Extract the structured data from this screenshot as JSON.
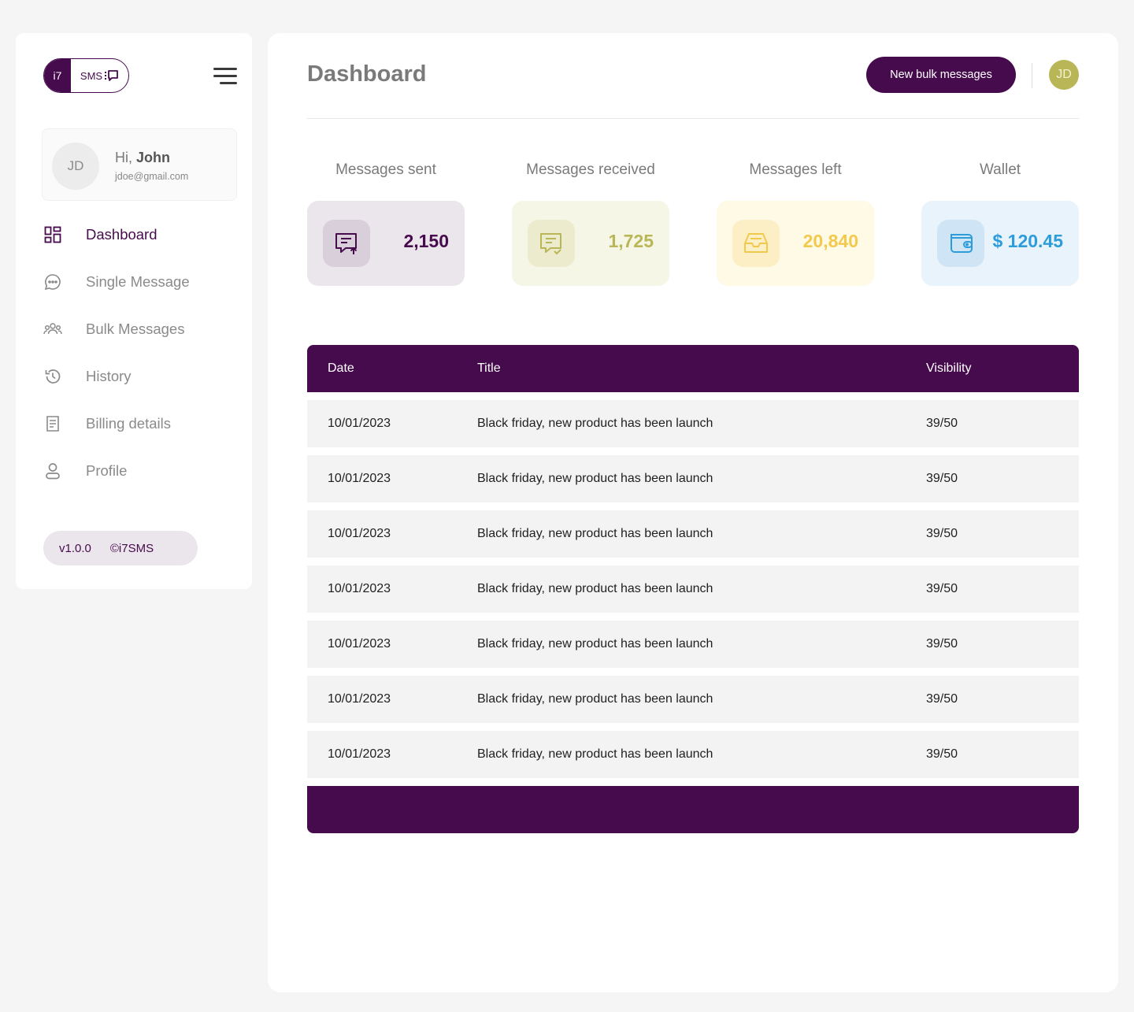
{
  "colors": {
    "brand": "#460b4c",
    "page_bg": "#f5f5f5",
    "sent_bg": "#ebe5ec",
    "received_bg": "#f6f6e6",
    "left_bg": "#fffae6",
    "wallet_bg": "#e8f3fb",
    "received_accent": "#b8b656",
    "left_accent": "#f2c94c",
    "wallet_accent": "#2d9cdb"
  },
  "logo": {
    "left": "i7",
    "right": "SMS"
  },
  "user": {
    "initials": "JD",
    "greeting": "Hi,",
    "name": "John",
    "email": "jdoe@gmail.com"
  },
  "nav": {
    "items": [
      {
        "label": "Dashboard",
        "icon": "dashboard-icon",
        "active": true
      },
      {
        "label": "Single Message",
        "icon": "chat-bubble-icon"
      },
      {
        "label": "Bulk Messages",
        "icon": "users-group-icon"
      },
      {
        "label": "History",
        "icon": "history-icon"
      },
      {
        "label": "Billing details",
        "icon": "receipt-icon"
      },
      {
        "label": "Profile",
        "icon": "user-icon"
      }
    ]
  },
  "footer": {
    "version": "v1.0.0",
    "copyright": "©i7SMS"
  },
  "header": {
    "title": "Dashboard",
    "button_label": "New bulk messages",
    "avatar_initials": "JD"
  },
  "stats": [
    {
      "title": "Messages sent",
      "value": "2,150",
      "icon": "message-upload-icon"
    },
    {
      "title": "Messages received",
      "value": "1,725",
      "icon": "message-check-icon"
    },
    {
      "title": "Messages left",
      "value": "20,840",
      "icon": "inbox-icon"
    },
    {
      "title": "Wallet",
      "value": "$ 120.45",
      "icon": "wallet-icon"
    }
  ],
  "table": {
    "headers": {
      "date": "Date",
      "title": "Title",
      "visibility": "Visibility"
    },
    "rows": [
      {
        "date": "10/01/2023",
        "title": "Black friday, new product has been launch",
        "visibility": "39/50"
      },
      {
        "date": "10/01/2023",
        "title": "Black friday, new product has been launch",
        "visibility": "39/50"
      },
      {
        "date": "10/01/2023",
        "title": "Black friday, new product has been launch",
        "visibility": "39/50"
      },
      {
        "date": "10/01/2023",
        "title": "Black friday, new product has been launch",
        "visibility": "39/50"
      },
      {
        "date": "10/01/2023",
        "title": "Black friday, new product has been launch",
        "visibility": "39/50"
      },
      {
        "date": "10/01/2023",
        "title": "Black friday, new product has been launch",
        "visibility": "39/50"
      },
      {
        "date": "10/01/2023",
        "title": "Black friday, new product has been launch",
        "visibility": "39/50"
      }
    ]
  }
}
